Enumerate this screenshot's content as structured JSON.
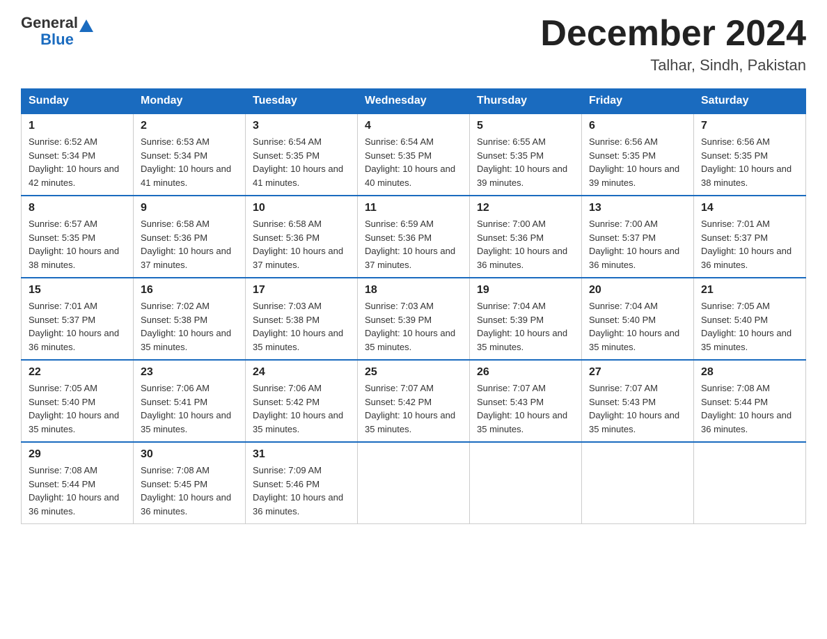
{
  "logo": {
    "general": "General",
    "blue": "Blue"
  },
  "header": {
    "month": "December 2024",
    "location": "Talhar, Sindh, Pakistan"
  },
  "weekdays": [
    "Sunday",
    "Monday",
    "Tuesday",
    "Wednesday",
    "Thursday",
    "Friday",
    "Saturday"
  ],
  "weeks": [
    [
      {
        "day": "1",
        "sunrise": "6:52 AM",
        "sunset": "5:34 PM",
        "daylight": "10 hours and 42 minutes."
      },
      {
        "day": "2",
        "sunrise": "6:53 AM",
        "sunset": "5:34 PM",
        "daylight": "10 hours and 41 minutes."
      },
      {
        "day": "3",
        "sunrise": "6:54 AM",
        "sunset": "5:35 PM",
        "daylight": "10 hours and 41 minutes."
      },
      {
        "day": "4",
        "sunrise": "6:54 AM",
        "sunset": "5:35 PM",
        "daylight": "10 hours and 40 minutes."
      },
      {
        "day": "5",
        "sunrise": "6:55 AM",
        "sunset": "5:35 PM",
        "daylight": "10 hours and 39 minutes."
      },
      {
        "day": "6",
        "sunrise": "6:56 AM",
        "sunset": "5:35 PM",
        "daylight": "10 hours and 39 minutes."
      },
      {
        "day": "7",
        "sunrise": "6:56 AM",
        "sunset": "5:35 PM",
        "daylight": "10 hours and 38 minutes."
      }
    ],
    [
      {
        "day": "8",
        "sunrise": "6:57 AM",
        "sunset": "5:35 PM",
        "daylight": "10 hours and 38 minutes."
      },
      {
        "day": "9",
        "sunrise": "6:58 AM",
        "sunset": "5:36 PM",
        "daylight": "10 hours and 37 minutes."
      },
      {
        "day": "10",
        "sunrise": "6:58 AM",
        "sunset": "5:36 PM",
        "daylight": "10 hours and 37 minutes."
      },
      {
        "day": "11",
        "sunrise": "6:59 AM",
        "sunset": "5:36 PM",
        "daylight": "10 hours and 37 minutes."
      },
      {
        "day": "12",
        "sunrise": "7:00 AM",
        "sunset": "5:36 PM",
        "daylight": "10 hours and 36 minutes."
      },
      {
        "day": "13",
        "sunrise": "7:00 AM",
        "sunset": "5:37 PM",
        "daylight": "10 hours and 36 minutes."
      },
      {
        "day": "14",
        "sunrise": "7:01 AM",
        "sunset": "5:37 PM",
        "daylight": "10 hours and 36 minutes."
      }
    ],
    [
      {
        "day": "15",
        "sunrise": "7:01 AM",
        "sunset": "5:37 PM",
        "daylight": "10 hours and 36 minutes."
      },
      {
        "day": "16",
        "sunrise": "7:02 AM",
        "sunset": "5:38 PM",
        "daylight": "10 hours and 35 minutes."
      },
      {
        "day": "17",
        "sunrise": "7:03 AM",
        "sunset": "5:38 PM",
        "daylight": "10 hours and 35 minutes."
      },
      {
        "day": "18",
        "sunrise": "7:03 AM",
        "sunset": "5:39 PM",
        "daylight": "10 hours and 35 minutes."
      },
      {
        "day": "19",
        "sunrise": "7:04 AM",
        "sunset": "5:39 PM",
        "daylight": "10 hours and 35 minutes."
      },
      {
        "day": "20",
        "sunrise": "7:04 AM",
        "sunset": "5:40 PM",
        "daylight": "10 hours and 35 minutes."
      },
      {
        "day": "21",
        "sunrise": "7:05 AM",
        "sunset": "5:40 PM",
        "daylight": "10 hours and 35 minutes."
      }
    ],
    [
      {
        "day": "22",
        "sunrise": "7:05 AM",
        "sunset": "5:40 PM",
        "daylight": "10 hours and 35 minutes."
      },
      {
        "day": "23",
        "sunrise": "7:06 AM",
        "sunset": "5:41 PM",
        "daylight": "10 hours and 35 minutes."
      },
      {
        "day": "24",
        "sunrise": "7:06 AM",
        "sunset": "5:42 PM",
        "daylight": "10 hours and 35 minutes."
      },
      {
        "day": "25",
        "sunrise": "7:07 AM",
        "sunset": "5:42 PM",
        "daylight": "10 hours and 35 minutes."
      },
      {
        "day": "26",
        "sunrise": "7:07 AM",
        "sunset": "5:43 PM",
        "daylight": "10 hours and 35 minutes."
      },
      {
        "day": "27",
        "sunrise": "7:07 AM",
        "sunset": "5:43 PM",
        "daylight": "10 hours and 35 minutes."
      },
      {
        "day": "28",
        "sunrise": "7:08 AM",
        "sunset": "5:44 PM",
        "daylight": "10 hours and 36 minutes."
      }
    ],
    [
      {
        "day": "29",
        "sunrise": "7:08 AM",
        "sunset": "5:44 PM",
        "daylight": "10 hours and 36 minutes."
      },
      {
        "day": "30",
        "sunrise": "7:08 AM",
        "sunset": "5:45 PM",
        "daylight": "10 hours and 36 minutes."
      },
      {
        "day": "31",
        "sunrise": "7:09 AM",
        "sunset": "5:46 PM",
        "daylight": "10 hours and 36 minutes."
      },
      null,
      null,
      null,
      null
    ]
  ]
}
